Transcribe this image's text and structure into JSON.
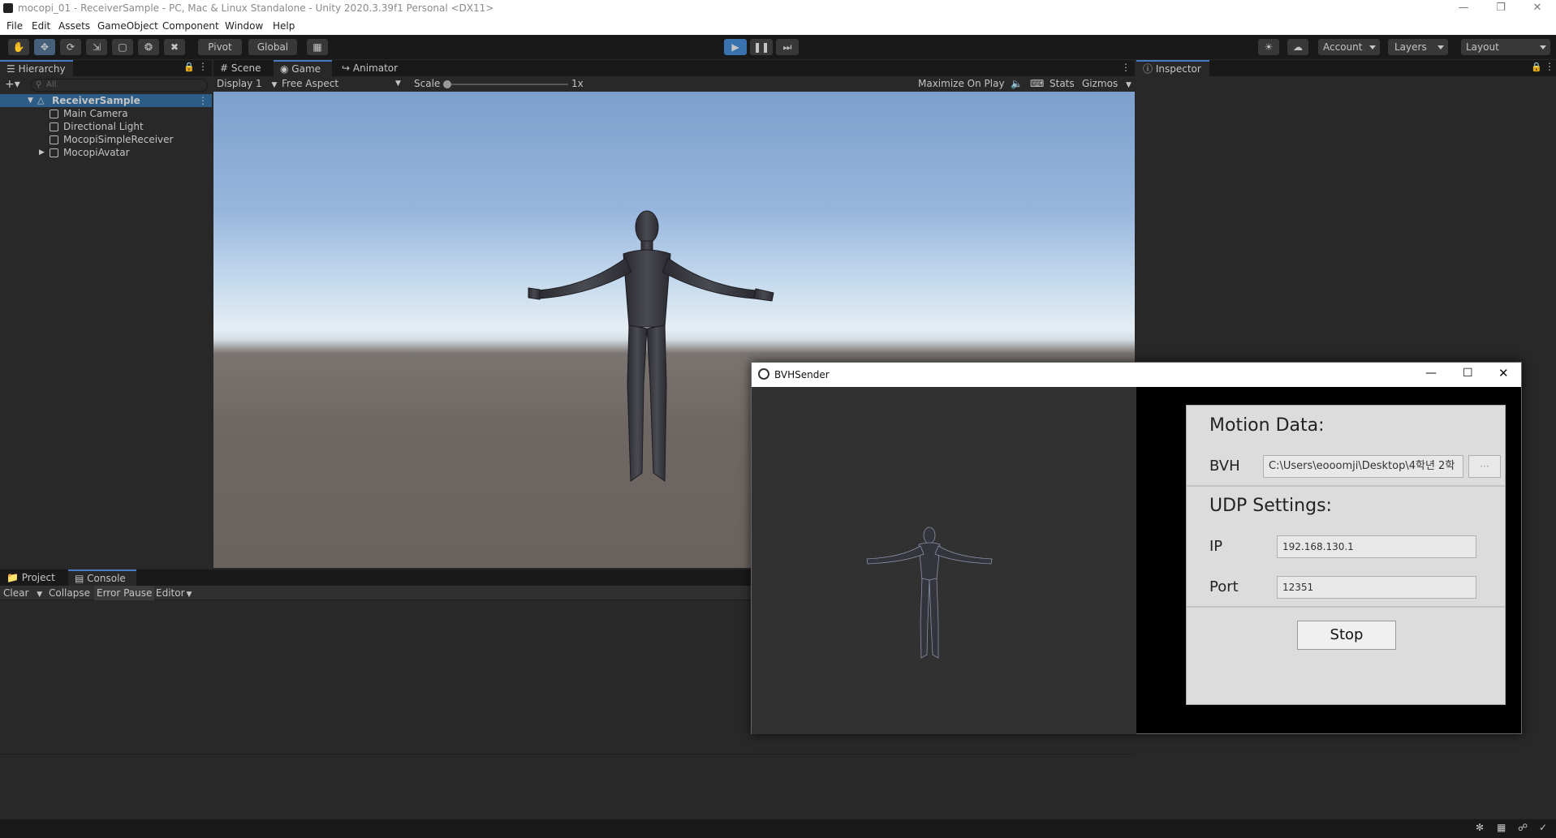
{
  "window": {
    "title": "mocopi_01 - ReceiverSample - PC, Mac & Linux Standalone - Unity 2020.3.39f1 Personal <DX11>"
  },
  "menu": [
    "File",
    "Edit",
    "Assets",
    "GameObject",
    "Component",
    "Window",
    "Help"
  ],
  "toolbar": {
    "pivot_label": "Pivot",
    "global_label": "Global",
    "account_label": "Account",
    "layers_label": "Layers",
    "layout_label": "Layout"
  },
  "hierarchy": {
    "tab_label": "Hierarchy",
    "search_placeholder": "All",
    "scene_name": "ReceiverSample",
    "items": [
      {
        "label": "Main Camera"
      },
      {
        "label": "Directional Light"
      },
      {
        "label": "MocopiSimpleReceiver"
      },
      {
        "label": "MocopiAvatar"
      }
    ]
  },
  "view_tabs": {
    "scene": "Scene",
    "game": "Game",
    "animator": "Animator"
  },
  "game_bar": {
    "display": "Display 1",
    "aspect": "Free Aspect",
    "scale_label": "Scale",
    "scale_value": "1x",
    "maximize": "Maximize On Play",
    "stats": "Stats",
    "gizmos": "Gizmos"
  },
  "inspector": {
    "tab_label": "Inspector"
  },
  "bottom_tabs": {
    "project": "Project",
    "console": "Console"
  },
  "console_bar": {
    "clear": "Clear",
    "collapse": "Collapse",
    "error_pause": "Error Pause",
    "editor": "Editor"
  },
  "bvh_sender": {
    "title": "BVHSender",
    "motion_title": "Motion Data:",
    "bvh_label": "BVH",
    "bvh_path": "C:\\Users\\eooomji\\Desktop\\4학년 2학",
    "browse_label": "···",
    "udp_title": "UDP Settings:",
    "ip_label": "IP",
    "ip_value": "192.168.130.1",
    "port_label": "Port",
    "port_value": "12351",
    "stop_label": "Stop"
  }
}
